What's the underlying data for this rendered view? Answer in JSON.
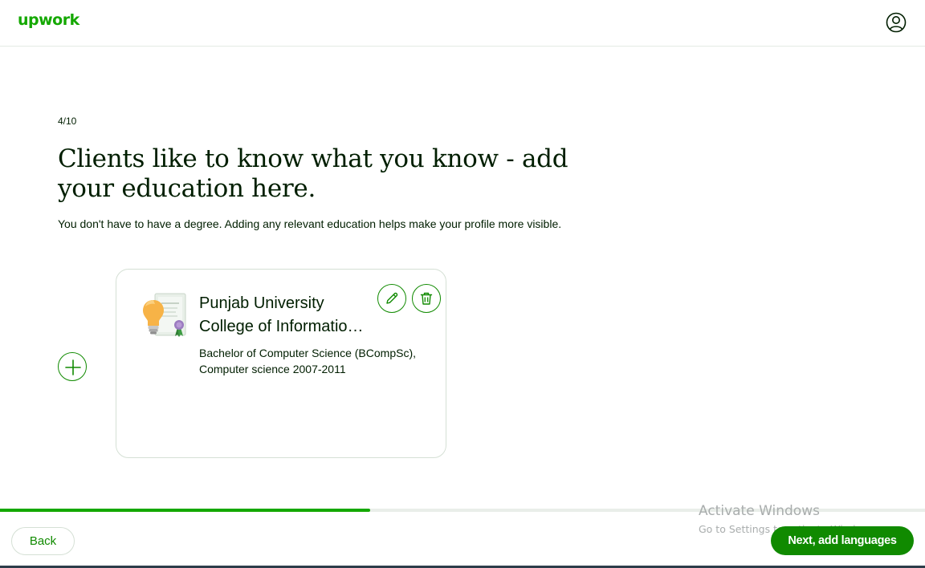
{
  "header": {
    "logo_text": "upwork",
    "account_icon": "user-circle-icon"
  },
  "main": {
    "step": "4/10",
    "title": "Clients like to know what you know - add your education here.",
    "subtitle": "You don't have to have a degree. Adding any relevant education helps make your profile more visible.",
    "add_icon": "plus-circle-icon"
  },
  "education_card": {
    "illustration": "education-certificate-lightbulb-icon",
    "school_line1": "Punjab University",
    "school_line2": "College of Informatio…",
    "degree": "Bachelor of Computer Science (BCompSc), Computer science 2007-2011",
    "edit_icon": "pencil-icon",
    "delete_icon": "trash-icon"
  },
  "progress": {
    "fraction": 0.4
  },
  "footer": {
    "back_label": "Back",
    "next_label": "Next, add languages"
  },
  "watermark": {
    "title": "Activate Windows",
    "subtitle": "Go to Settings to activate Windows."
  },
  "colors": {
    "brand_green": "#14a800",
    "button_green": "#108a00",
    "text_dark": "#001e00"
  }
}
